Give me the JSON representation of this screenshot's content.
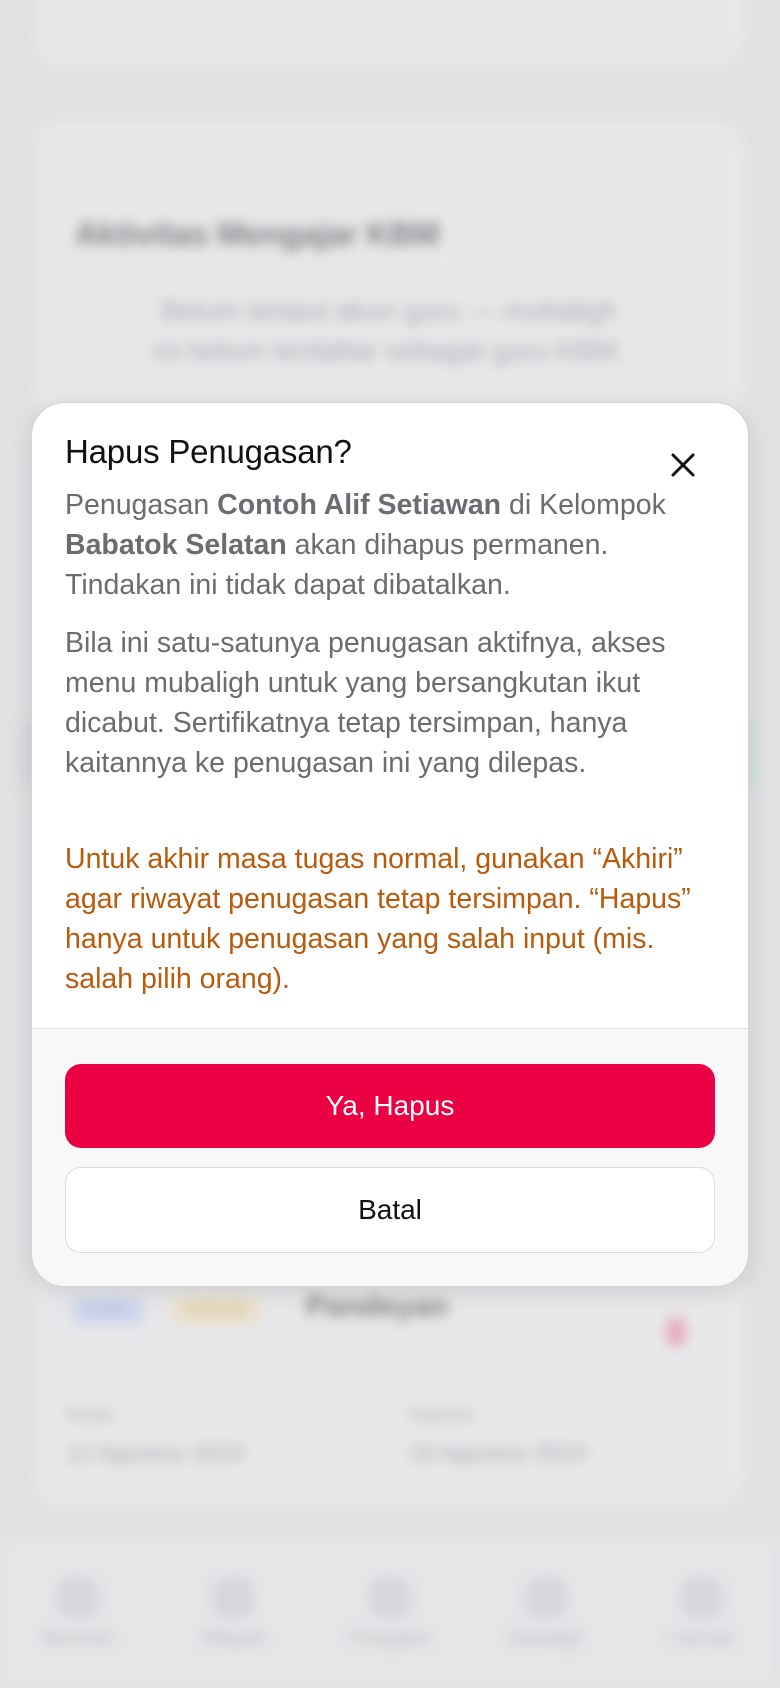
{
  "background": {
    "kbm_title": "Aktivitas Mengajar KBM",
    "kbm_empty_text": "Belum tertaut akun guru — mubaligh ini belum terdaftar sebagai guru KBM.",
    "badges": [
      "GURU",
      "STIKAM"
    ],
    "assignment_name": "Pandeyan",
    "start_label": "Mulai",
    "start_value": "12 Agustus 2024",
    "end_label": "Selesai",
    "end_value": "19 Agustus 2024",
    "nav": [
      {
        "label": "Beranda",
        "icon": "home-icon"
      },
      {
        "label": "Wilayah",
        "icon": "map-icon"
      },
      {
        "label": "Pengajian",
        "icon": "book-icon"
      },
      {
        "label": "Mubaligh",
        "icon": "user-icon"
      },
      {
        "label": "Lainnya",
        "icon": "grid-icon"
      }
    ]
  },
  "dialog": {
    "title": "Hapus Penugasan?",
    "p1": {
      "prefix": "Penugasan ",
      "person": "Contoh Alif Setiawan",
      "middle": " di Kelompok ",
      "group": "Babatok Selatan",
      "suffix": " akan dihapus permanen. Tindakan ini tidak dapat dibatalkan."
    },
    "p2": "Bila ini satu-satunya penugasan aktifnya, akses menu mubaligh untuk yang bersangkutan ikut dicabut. Sertifikatnya tetap tersimpan, hanya kaitannya ke penugasan ini yang dilepas.",
    "warning": "Untuk akhir masa tugas normal, gunakan “Akhiri” agar riwayat penugasan tetap tersimpan. “Hapus” hanya untuk penugasan yang salah input (mis. salah pilih orang).",
    "confirm_label": "Ya, Hapus",
    "cancel_label": "Batal",
    "close_icon": "close-icon"
  },
  "colors": {
    "danger": "#EC0044",
    "warning_text": "#B95A0C",
    "body_text": "#6B6B72"
  }
}
